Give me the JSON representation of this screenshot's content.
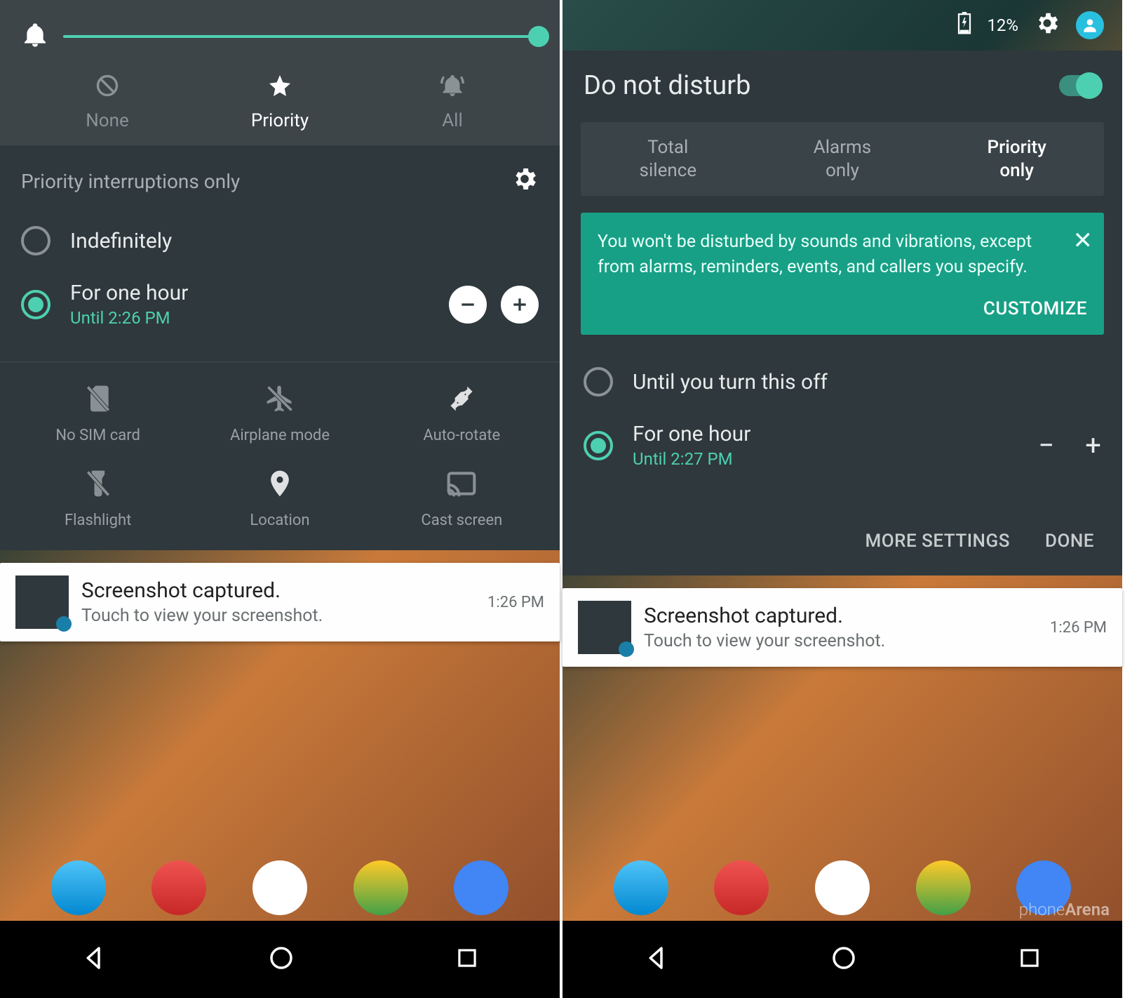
{
  "left": {
    "modes": [
      {
        "label": "None"
      },
      {
        "label": "Priority"
      },
      {
        "label": "All"
      }
    ],
    "priority_header": "Priority interruptions only",
    "options": [
      {
        "label": "Indefinitely",
        "selected": false
      },
      {
        "label": "For one hour",
        "sub": "Until 2:26 PM",
        "selected": true
      }
    ],
    "tiles": [
      "No SIM card",
      "Airplane mode",
      "Auto-rotate",
      "Flashlight",
      "Location",
      "Cast screen"
    ],
    "notif": {
      "title": "Screenshot captured.",
      "sub": "Touch to view your screenshot.",
      "time": "1:26 PM"
    }
  },
  "right": {
    "battery": "12%",
    "title": "Do not disturb",
    "tabs": [
      {
        "l1": "Total",
        "l2": "silence"
      },
      {
        "l1": "Alarms",
        "l2": "only"
      },
      {
        "l1": "Priority",
        "l2": "only"
      }
    ],
    "info": "You won't be disturbed by sounds and vibrations, except from alarms, reminders, events, and callers you specify.",
    "customize": "CUSTOMIZE",
    "options": [
      {
        "label": "Until you turn this off",
        "selected": false
      },
      {
        "label": "For one hour",
        "sub": "Until 2:27 PM",
        "selected": true
      }
    ],
    "actions": {
      "more": "MORE SETTINGS",
      "done": "DONE"
    },
    "notif": {
      "title": "Screenshot captured.",
      "sub": "Touch to view your screenshot.",
      "time": "1:26 PM"
    },
    "watermark": "phoneArena"
  }
}
